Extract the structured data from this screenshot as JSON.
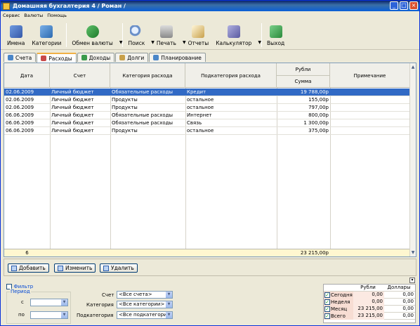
{
  "window": {
    "title": "Домашняя бухгалтерия 4  / Роман /",
    "min": "_",
    "max": "□",
    "close": "×"
  },
  "menu": [
    "Сервис",
    "Валюты",
    "Помощь"
  ],
  "toolbar": [
    {
      "label": "Имена",
      "icon": "people-icon",
      "color": "#5a7ec8"
    },
    {
      "label": "Категории",
      "icon": "categories-icon",
      "color": "#4a86c8"
    },
    {
      "label": "Обмен валюты",
      "icon": "currency-exchange-icon",
      "color": "#2e8b3a"
    },
    {
      "label": "Поиск",
      "icon": "search-icon",
      "color": "#6a8fc8"
    },
    {
      "label": "Печать",
      "icon": "printer-icon",
      "color": "#8a8a8a"
    },
    {
      "label": "Отчеты",
      "icon": "reports-icon",
      "color": "#c8a04a"
    },
    {
      "label": "Калькулятор",
      "icon": "calculator-icon",
      "color": "#7a7ab0"
    },
    {
      "label": "Выход",
      "icon": "exit-icon",
      "color": "#3a9a4a"
    }
  ],
  "tabs": [
    {
      "label": "Счета",
      "active": false,
      "color": "#4a86c8"
    },
    {
      "label": "Расходы",
      "active": true,
      "color": "#c84a4a"
    },
    {
      "label": "Доходы",
      "active": false,
      "color": "#3a9a4a"
    },
    {
      "label": "Долги",
      "active": false,
      "color": "#c8a04a"
    },
    {
      "label": "Планирование",
      "active": false,
      "color": "#4a86c8"
    }
  ],
  "grid": {
    "headers": {
      "date": "Дата",
      "account": "Счет",
      "category": "Категория расхода",
      "subcategory": "Подкатегория расхода",
      "currency": "Рубли",
      "sum": "Сумма",
      "note": "Примечание"
    },
    "rows": [
      {
        "date": "02.06.2009",
        "account": "Личный бюджет",
        "category": "Обязательные расходы",
        "subcategory": "Кредит",
        "sum": "19 788,00р",
        "note": "",
        "selected": true
      },
      {
        "date": "02.06.2009",
        "account": "Личный бюджет",
        "category": "Продукты",
        "subcategory": "остальное",
        "sum": "155,00р",
        "note": "",
        "selected": false
      },
      {
        "date": "02.06.2009",
        "account": "Личный бюджет",
        "category": "Продукты",
        "subcategory": "остальное",
        "sum": "797,00р",
        "note": "",
        "selected": false
      },
      {
        "date": "06.06.2009",
        "account": "Личный бюджет",
        "category": "Обязательные расходы",
        "subcategory": "Интернет",
        "sum": "800,00р",
        "note": "",
        "selected": false
      },
      {
        "date": "06.06.2009",
        "account": "Личный бюджет",
        "category": "Обязательные расходы",
        "subcategory": "Связь",
        "sum": "1 300,00р",
        "note": "",
        "selected": false
      },
      {
        "date": "06.06.2009",
        "account": "Личный бюджет",
        "category": "Продукты",
        "subcategory": "остальное",
        "sum": "375,00р",
        "note": "",
        "selected": false
      }
    ],
    "footer": {
      "count": "6",
      "total": "23 215,00р"
    }
  },
  "actions": {
    "add": "Добавить",
    "edit": "Изменить",
    "delete": "Удалить"
  },
  "filter": {
    "label": "Фильтр",
    "period": "Период",
    "from": "с",
    "to": "по",
    "account_label": "Счет",
    "account_value": "<Все счета>",
    "category_label": "Категория",
    "category_value": "<Все категории>",
    "subcategory_label": "Подкатегория",
    "subcategory_value": "<Все подкатегори"
  },
  "summary": {
    "col_rub": "Рубли",
    "col_usd": "Доллары",
    "rows": [
      {
        "label": "Сегодня",
        "rub": "0,00",
        "usd": "0,00"
      },
      {
        "label": "Неделя",
        "rub": "0,00",
        "usd": "0,00"
      },
      {
        "label": "Месяц",
        "rub": "23 215,00",
        "usd": "0,00"
      },
      {
        "label": "Всего",
        "rub": "23 215,00",
        "usd": "0,00"
      }
    ]
  }
}
